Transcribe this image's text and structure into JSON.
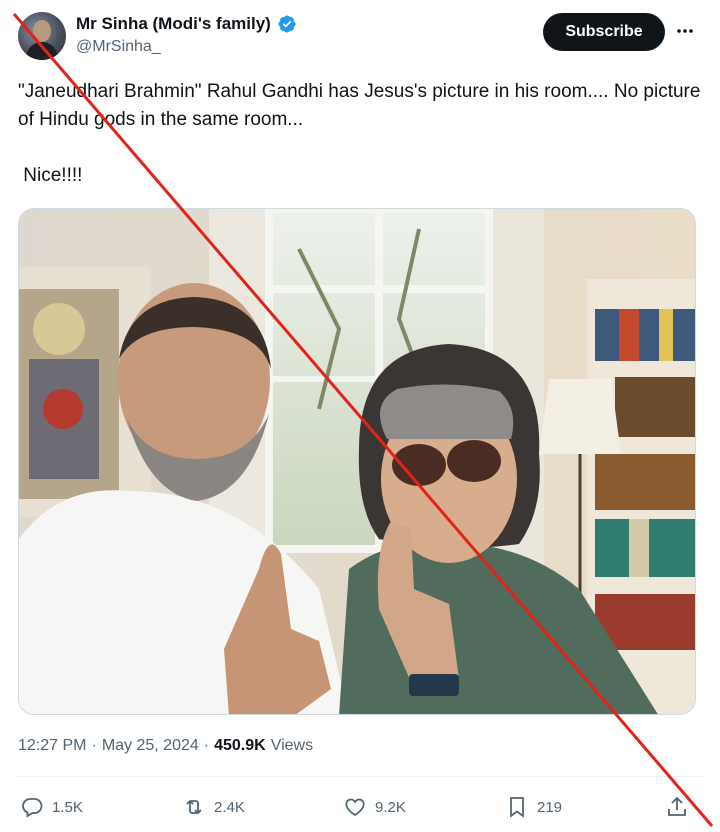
{
  "author": {
    "display_name": "Mr Sinha (Modi's family)",
    "handle": "@MrSinha_",
    "verified": true
  },
  "header": {
    "subscribe_label": "Subscribe",
    "more_icon": "ellipsis-icon"
  },
  "tweet": {
    "line1": "\"Janeudhari Brahmin\" Rahul Gandhi has Jesus's picture in his room.... No picture of Hindu gods in the same room...",
    "line2": " Nice!!!!"
  },
  "meta": {
    "time": "12:27 PM",
    "separator": "·",
    "date": "May 25, 2024",
    "views_count": "450.9K",
    "views_label": "Views"
  },
  "actions": {
    "replies": "1.5K",
    "reposts": "2.4K",
    "likes": "9.2K",
    "bookmarks": "219"
  },
  "colors": {
    "text": "#0f1419",
    "secondary": "#536471",
    "verified": "#1d9bf0",
    "overlay_cross": "#e2231a"
  }
}
